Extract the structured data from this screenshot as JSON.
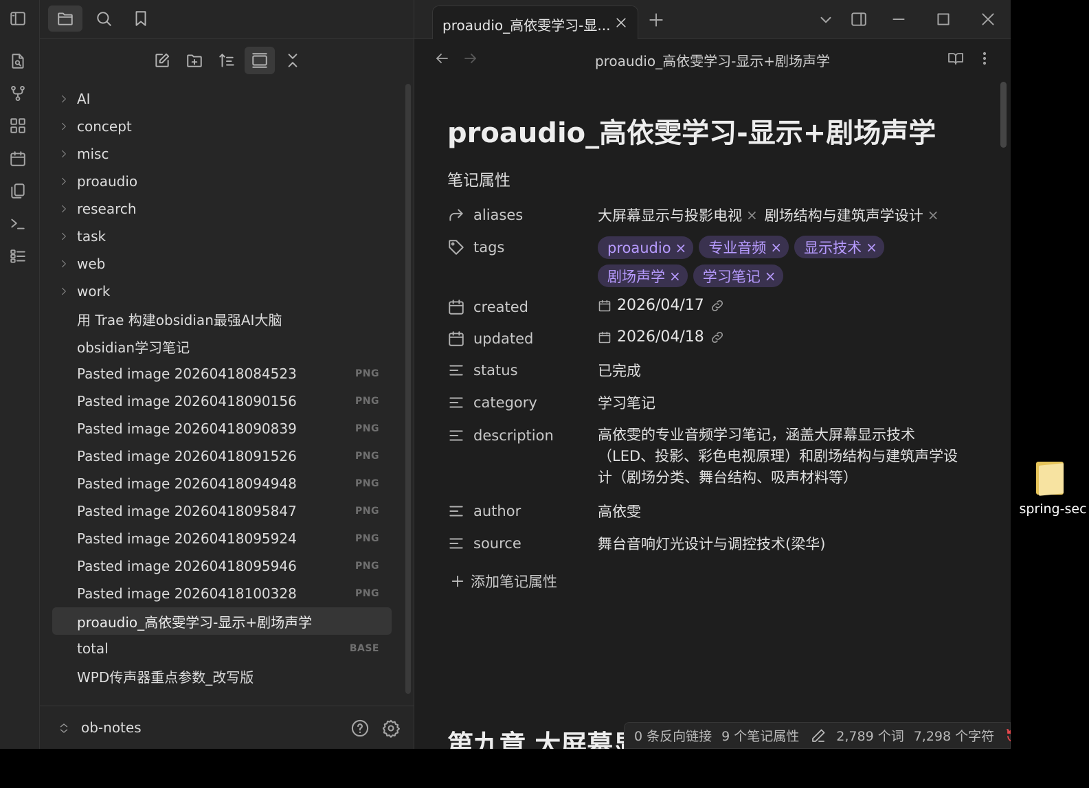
{
  "desktop": {
    "folder_label": "spring-sec"
  },
  "sidebar": {
    "top_icons": [
      "sidebar-toggle-icon",
      "folder-icon",
      "search-icon",
      "bookmark-icon"
    ],
    "nav_actions": [
      "new-note-icon",
      "new-folder-icon",
      "sort-icon",
      "collapse-view-icon",
      "collapse-all-icon"
    ],
    "tree": [
      {
        "label": "AI",
        "folder": true,
        "ext": ""
      },
      {
        "label": "concept",
        "folder": true,
        "ext": ""
      },
      {
        "label": "misc",
        "folder": true,
        "ext": ""
      },
      {
        "label": "proaudio",
        "folder": true,
        "ext": ""
      },
      {
        "label": "research",
        "folder": true,
        "ext": ""
      },
      {
        "label": "task",
        "folder": true,
        "ext": ""
      },
      {
        "label": "web",
        "folder": true,
        "ext": ""
      },
      {
        "label": "work",
        "folder": true,
        "ext": ""
      },
      {
        "label": "用 Trae 构建obsidian最强AI大脑",
        "folder": false,
        "ext": ""
      },
      {
        "label": "obsidian学习笔记",
        "folder": false,
        "ext": ""
      },
      {
        "label": "Pasted image 20260418084523",
        "folder": false,
        "ext": "PNG"
      },
      {
        "label": "Pasted image 20260418090156",
        "folder": false,
        "ext": "PNG"
      },
      {
        "label": "Pasted image 20260418090839",
        "folder": false,
        "ext": "PNG"
      },
      {
        "label": "Pasted image 20260418091526",
        "folder": false,
        "ext": "PNG"
      },
      {
        "label": "Pasted image 20260418094948",
        "folder": false,
        "ext": "PNG"
      },
      {
        "label": "Pasted image 20260418095847",
        "folder": false,
        "ext": "PNG"
      },
      {
        "label": "Pasted image 20260418095924",
        "folder": false,
        "ext": "PNG"
      },
      {
        "label": "Pasted image 20260418095946",
        "folder": false,
        "ext": "PNG"
      },
      {
        "label": "Pasted image 20260418100328",
        "folder": false,
        "ext": "PNG"
      },
      {
        "label": "proaudio_高依雯学习-显示+剧场声学",
        "folder": false,
        "ext": "",
        "selected": true
      },
      {
        "label": "total",
        "folder": false,
        "ext": "BASE"
      },
      {
        "label": "WPD传声器重点参数_改写版",
        "folder": false,
        "ext": ""
      }
    ],
    "vault_name": "ob-notes"
  },
  "tab": {
    "title": "proaudio_高依雯学习-显..."
  },
  "header": {
    "title": "proaudio_高依雯学习-显示+剧场声学"
  },
  "note": {
    "title": "proaudio_高依雯学习-显示+剧场声学",
    "props_heading": "笔记属性",
    "properties": {
      "aliases": {
        "key": "aliases",
        "values": [
          "大屏幕显示与投影电视",
          "剧场结构与建筑声学设计"
        ]
      },
      "tags": {
        "key": "tags",
        "values": [
          "proaudio",
          "专业音频",
          "显示技术",
          "剧场声学",
          "学习笔记"
        ]
      },
      "created": {
        "key": "created",
        "value": "2026/04/17"
      },
      "updated": {
        "key": "updated",
        "value": "2026/04/18"
      },
      "status": {
        "key": "status",
        "value": "已完成"
      },
      "category": {
        "key": "category",
        "value": "学习笔记"
      },
      "description": {
        "key": "description",
        "value": "高依雯的专业音频学习笔记，涵盖大屏幕显示技术（LED、投影、彩色电视原理）和剧场结构与建筑声学设计（剧场分类、舞台结构、吸声材料等）"
      },
      "author": {
        "key": "author",
        "value": "高依雯"
      },
      "source": {
        "key": "source",
        "value": "舞台音响灯光设计与调控技术(梁华)"
      }
    },
    "add_property": "添加笔记属性",
    "chapter_heading": "第九章 大屏幕显"
  },
  "statusbar": {
    "backlinks": "0 条反向链接",
    "properties_count": "9 个笔记属性",
    "words": "2,789 个词",
    "chars": "7,298 个字符"
  },
  "colors": {
    "accent": "#b79bff",
    "tag_bg": "#3a324f",
    "sync_error": "#e5484d"
  }
}
